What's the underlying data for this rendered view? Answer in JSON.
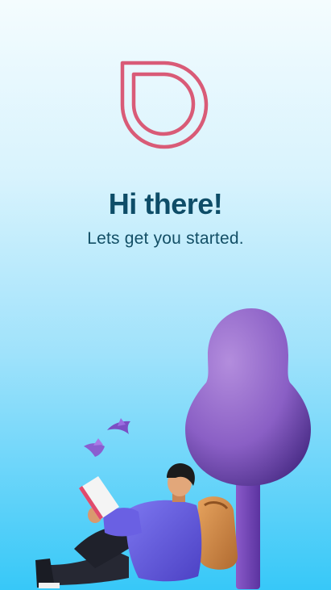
{
  "welcome": {
    "title": "Hi there!",
    "subtitle": "Lets get you started."
  },
  "icons": {
    "logo": "droplet-outline-logo"
  },
  "colors": {
    "logo": "#d95b77",
    "title": "#0e4d68",
    "background_top": "#f4fcfe",
    "background_bottom": "#37c8f8",
    "tree": "#8d62c6",
    "jacket": "#6a5fe0",
    "backpack": "#cf8846"
  }
}
